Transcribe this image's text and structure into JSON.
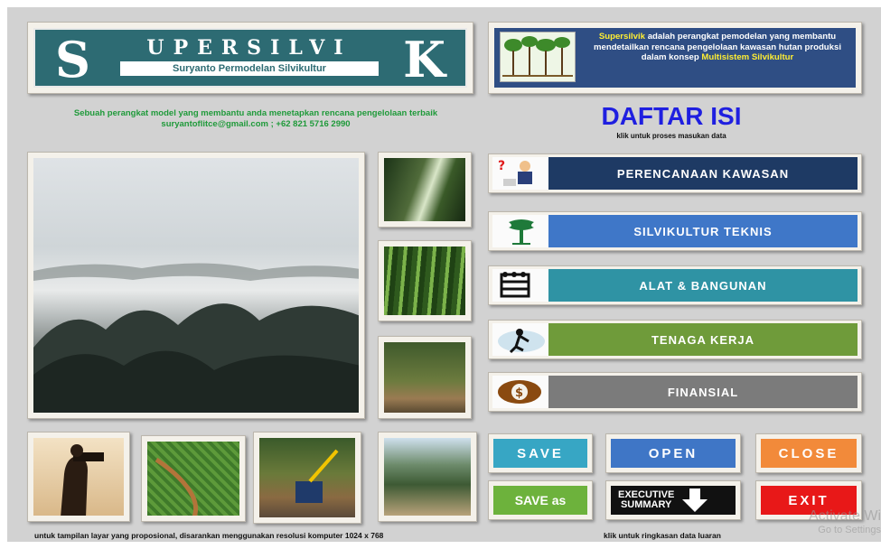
{
  "logo": {
    "big_s": "S",
    "word": "UPERSILVI",
    "big_k": "K",
    "subtitle": "Suryanto Permodelan Silvikultur"
  },
  "description": {
    "part1": "Supersilvik",
    "part2": " adalah perangkat pemodelan yang membantu mendetailkan rencana pengelolaan kawasan hutan produksi dalam konsep ",
    "part3": "Multisistem Silvikultur"
  },
  "tagline": {
    "line1": "Sebuah perangkat model yang membantu anda menetapkan rencana pengelolaan terbaik",
    "line2": "suryantoflitce@gmail.com ; +62 821 5716 2990"
  },
  "toc": {
    "title": "DAFTAR ISI",
    "subtitle": "klik untuk proses masukan data"
  },
  "menu": [
    {
      "label": "PERENCANAAN KAWASAN",
      "color": "#1e3a64",
      "icon": "planner-person-icon"
    },
    {
      "label": "SILVIKULTUR TEKNIS",
      "color": "#3f77c8",
      "icon": "tree-icon"
    },
    {
      "label": "ALAT & BANGUNAN",
      "color": "#2f93a4",
      "icon": "building-icon"
    },
    {
      "label": "TENAGA KERJA",
      "color": "#6f9b3a",
      "icon": "worker-icon"
    },
    {
      "label": "FINANSIAL",
      "color": "#7b7b7b",
      "icon": "money-icon"
    }
  ],
  "buttons": {
    "save": {
      "label": "SAVE",
      "color": "#37a6c4"
    },
    "open": {
      "label": "OPEN",
      "color": "#3f76c6"
    },
    "close": {
      "label": "CLOSE",
      "color": "#f28a3a"
    },
    "save_as": {
      "label": "SAVE as",
      "color": "#6db23c"
    },
    "executive_line1": "EXECUTIVE",
    "executive_line2": "SUMMARY",
    "executive_color": "#111111",
    "exit": {
      "label": "EXIT",
      "color": "#e81818"
    }
  },
  "footer": {
    "left": "untuk tampilan layar yang proposional,  disarankan menggunakan resolusi komputer 1024 x 768",
    "right": "klik untuk ringkasan data luaran"
  },
  "watermark": {
    "line1": "Activate Wi",
    "line2": "Go to Settings"
  }
}
